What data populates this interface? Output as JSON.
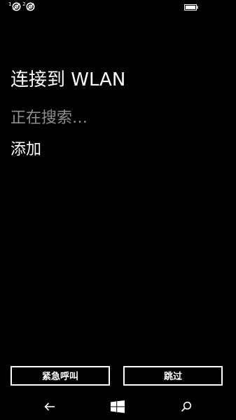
{
  "status_bar": {
    "sim1_number": "1",
    "sim2_number": "2"
  },
  "page": {
    "title": "连接到 WLAN",
    "status": "正在搜索…",
    "add_label": "添加"
  },
  "buttons": {
    "emergency_label": "紧急呼叫",
    "skip_label": "跳过"
  },
  "colors": {
    "background": "#000000",
    "foreground": "#ffffff",
    "muted_text": "#8f8f8f"
  },
  "icons": {
    "sim1": "sim-no-signal-icon",
    "sim2": "sim-no-signal-icon",
    "battery": "battery-icon",
    "back": "back-arrow-icon",
    "start": "windows-logo-icon",
    "search": "search-icon"
  }
}
